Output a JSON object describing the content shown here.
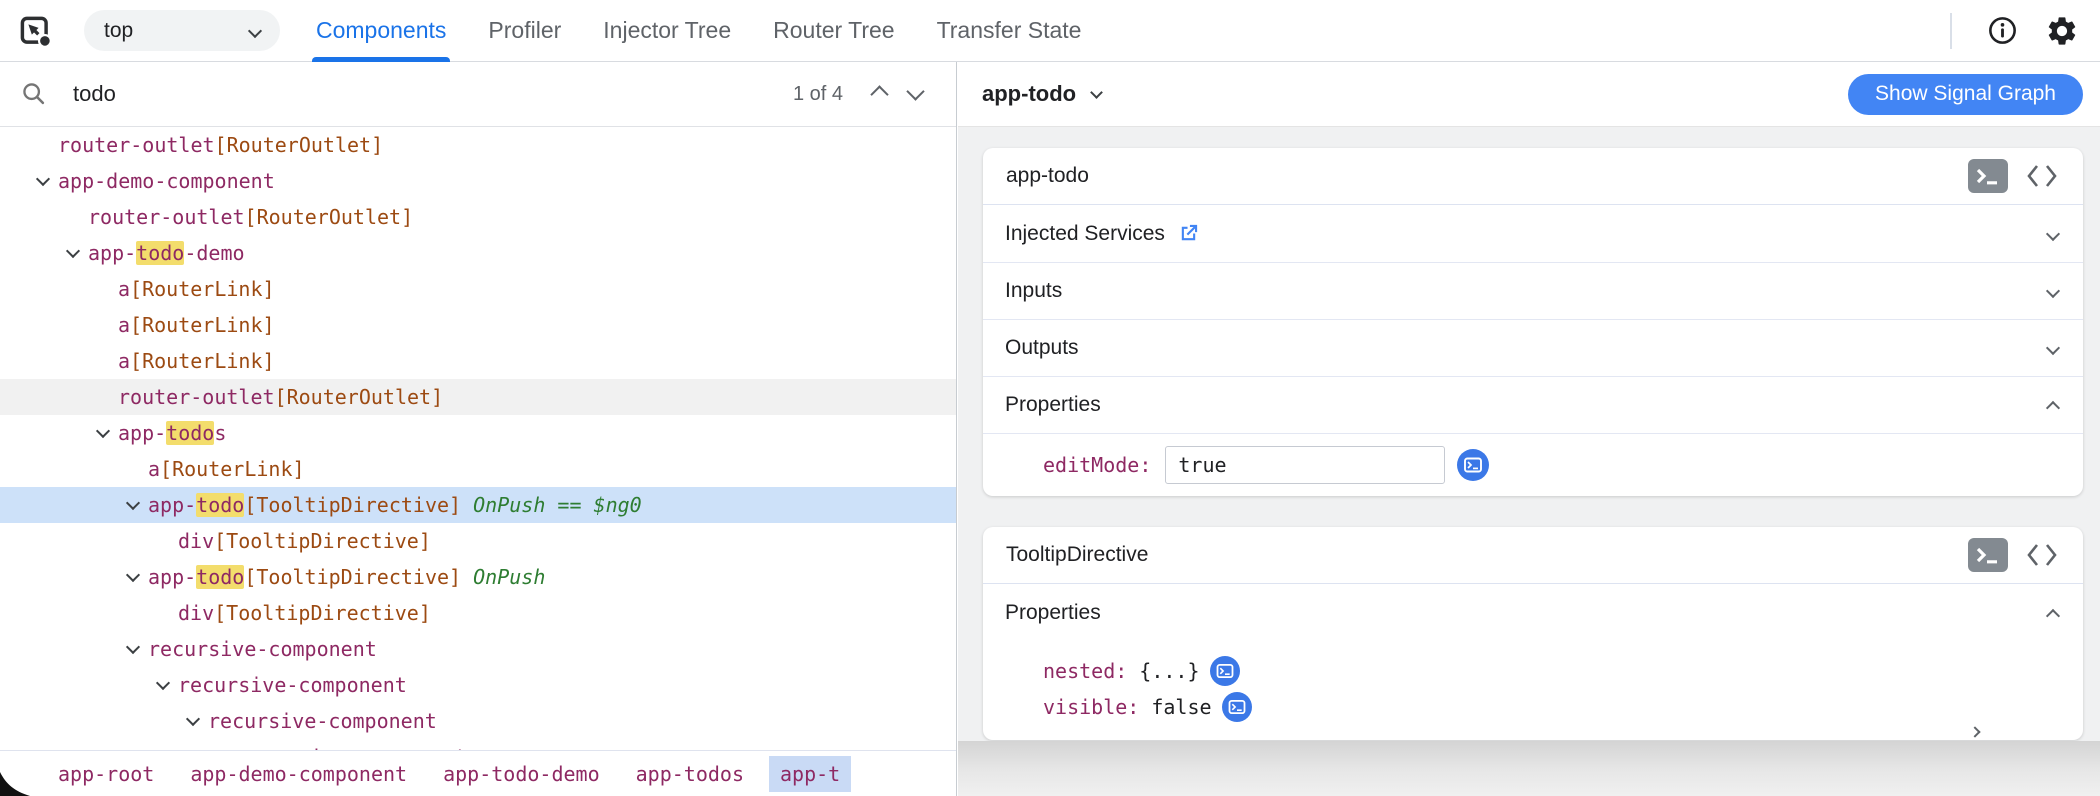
{
  "topbar": {
    "frame_selector": "top",
    "tabs": [
      {
        "label": "Components",
        "active": true
      },
      {
        "label": "Profiler",
        "active": false
      },
      {
        "label": "Injector Tree",
        "active": false
      },
      {
        "label": "Router Tree",
        "active": false
      },
      {
        "label": "Transfer State",
        "active": false
      }
    ]
  },
  "search": {
    "query": "todo",
    "match_counter": "1 of 4"
  },
  "colors": {
    "accent_blue": "#1a73e8",
    "button_blue": "#4285f4",
    "selected_row_blue": "#cde1f9",
    "match_highlight_yellow": "#f3dd6c",
    "element_name": "#8e2963",
    "directive_name": "#9c4a12",
    "change_detection_green": "#2e7d32"
  },
  "tree": {
    "rows": [
      {
        "level": 0,
        "expandable": false,
        "segments": [
          {
            "text": "router-outlet",
            "kind": "element"
          },
          {
            "text": "[RouterOutlet]",
            "kind": "directive"
          }
        ]
      },
      {
        "level": 0,
        "expandable": true,
        "segments": [
          {
            "text": "app-demo-component",
            "kind": "element"
          }
        ]
      },
      {
        "level": 1,
        "expandable": false,
        "segments": [
          {
            "text": "router-outlet",
            "kind": "element"
          },
          {
            "text": "[RouterOutlet]",
            "kind": "directive"
          }
        ]
      },
      {
        "level": 1,
        "expandable": true,
        "segments": [
          {
            "text": "app-",
            "kind": "element"
          },
          {
            "text": "todo",
            "kind": "element",
            "highlight": true
          },
          {
            "text": "-demo",
            "kind": "element"
          }
        ]
      },
      {
        "level": 2,
        "expandable": false,
        "segments": [
          {
            "text": "a",
            "kind": "element"
          },
          {
            "text": "[RouterLink]",
            "kind": "directive"
          }
        ]
      },
      {
        "level": 2,
        "expandable": false,
        "segments": [
          {
            "text": "a",
            "kind": "element"
          },
          {
            "text": "[RouterLink]",
            "kind": "directive"
          }
        ]
      },
      {
        "level": 2,
        "expandable": false,
        "segments": [
          {
            "text": "a",
            "kind": "element"
          },
          {
            "text": "[RouterLink]",
            "kind": "directive"
          }
        ]
      },
      {
        "level": 2,
        "expandable": false,
        "state": "hover",
        "segments": [
          {
            "text": "router-outlet",
            "kind": "element"
          },
          {
            "text": "[RouterOutlet]",
            "kind": "directive"
          }
        ]
      },
      {
        "level": 2,
        "expandable": true,
        "segments": [
          {
            "text": "app-",
            "kind": "element"
          },
          {
            "text": "todo",
            "kind": "element",
            "highlight": true
          },
          {
            "text": "s",
            "kind": "element"
          }
        ]
      },
      {
        "level": 3,
        "expandable": false,
        "segments": [
          {
            "text": "a",
            "kind": "element"
          },
          {
            "text": "[RouterLink]",
            "kind": "directive"
          }
        ]
      },
      {
        "level": 3,
        "expandable": true,
        "state": "selected",
        "segments": [
          {
            "text": "app-",
            "kind": "element"
          },
          {
            "text": "todo",
            "kind": "element",
            "highlight": true
          },
          {
            "text": "[TooltipDirective]",
            "kind": "directive"
          },
          {
            "text": " OnPush",
            "kind": "cd"
          },
          {
            "text": " == $ng0",
            "kind": "cd"
          }
        ]
      },
      {
        "level": 4,
        "expandable": false,
        "segments": [
          {
            "text": "div",
            "kind": "element"
          },
          {
            "text": "[TooltipDirective]",
            "kind": "directive"
          }
        ]
      },
      {
        "level": 3,
        "expandable": true,
        "segments": [
          {
            "text": "app-",
            "kind": "element"
          },
          {
            "text": "todo",
            "kind": "element",
            "highlight": true
          },
          {
            "text": "[TooltipDirective]",
            "kind": "directive"
          },
          {
            "text": " OnPush",
            "kind": "cd"
          }
        ]
      },
      {
        "level": 4,
        "expandable": false,
        "segments": [
          {
            "text": "div",
            "kind": "element"
          },
          {
            "text": "[TooltipDirective]",
            "kind": "directive"
          }
        ]
      },
      {
        "level": 3,
        "expandable": true,
        "segments": [
          {
            "text": "recursive-component",
            "kind": "element"
          }
        ]
      },
      {
        "level": 4,
        "expandable": true,
        "segments": [
          {
            "text": "recursive-component",
            "kind": "element"
          }
        ]
      },
      {
        "level": 5,
        "expandable": true,
        "segments": [
          {
            "text": "recursive-component",
            "kind": "element"
          }
        ]
      },
      {
        "level": 6,
        "expandable": true,
        "segments": [
          {
            "text": "recursive-component",
            "kind": "element"
          }
        ]
      }
    ]
  },
  "breadcrumbs": {
    "items": [
      {
        "label": "app-root",
        "active": false
      },
      {
        "label": "app-demo-component",
        "active": false
      },
      {
        "label": "app-todo-demo",
        "active": false
      },
      {
        "label": "app-todos",
        "active": false
      },
      {
        "label": "app-t",
        "active": true
      }
    ]
  },
  "inspector": {
    "selected_component": "app-todo",
    "show_signal_graph_label": "Show Signal Graph",
    "component_card": {
      "title": "app-todo",
      "section_injected_services": "Injected Services",
      "section_inputs": "Inputs",
      "section_outputs": "Outputs",
      "section_properties": "Properties",
      "prop_editmode": {
        "label": "editMode:",
        "value": "true"
      }
    },
    "directive_card": {
      "title": "TooltipDirective",
      "section_properties": "Properties",
      "prop_nested": {
        "label": "nested:",
        "value": "{...}"
      },
      "prop_visible": {
        "label": "visible:",
        "value": "false"
      }
    }
  }
}
